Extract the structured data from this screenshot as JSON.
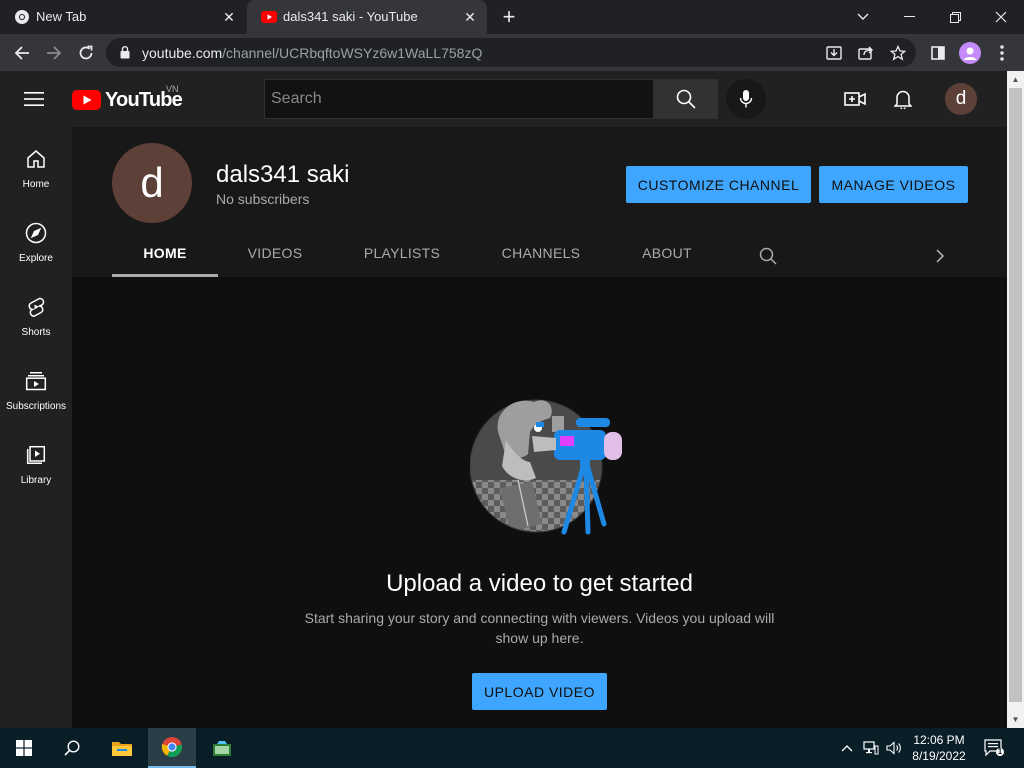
{
  "browser": {
    "tabs": [
      {
        "title": "New Tab",
        "active": false
      },
      {
        "title": "dals341 saki - YouTube",
        "active": true
      }
    ],
    "url_host": "youtube.com",
    "url_path": "/channel/UCRbqftoWSYz6w1WaLL758zQ"
  },
  "masthead": {
    "logo_text": "YouTube",
    "country_code": "VN",
    "search_placeholder": "Search",
    "avatar_letter": "d"
  },
  "guide": {
    "items": [
      {
        "label": "Home",
        "icon": "home-icon"
      },
      {
        "label": "Explore",
        "icon": "compass-icon"
      },
      {
        "label": "Shorts",
        "icon": "shorts-icon"
      },
      {
        "label": "Subscriptions",
        "icon": "subscriptions-icon"
      },
      {
        "label": "Library",
        "icon": "library-icon"
      }
    ]
  },
  "channel": {
    "avatar_letter": "d",
    "name": "dals341 saki",
    "subscribers": "No subscribers",
    "customize_label": "CUSTOMIZE CHANNEL",
    "manage_label": "MANAGE VIDEOS",
    "tabs": [
      {
        "label": "HOME",
        "active": true
      },
      {
        "label": "VIDEOS",
        "active": false
      },
      {
        "label": "PLAYLISTS",
        "active": false
      },
      {
        "label": "CHANNELS",
        "active": false
      },
      {
        "label": "ABOUT",
        "active": false
      }
    ]
  },
  "empty_state": {
    "title": "Upload a video to get started",
    "description": "Start sharing your story and connecting with viewers. Videos you upload will show up here.",
    "button_label": "UPLOAD VIDEO"
  },
  "taskbar": {
    "time": "12:06 PM",
    "date": "8/19/2022",
    "notification_count": "1"
  },
  "colors": {
    "accent_blue": "#3ea6ff",
    "youtube_red": "#ff0000",
    "avatar_brown": "#5d4037"
  }
}
